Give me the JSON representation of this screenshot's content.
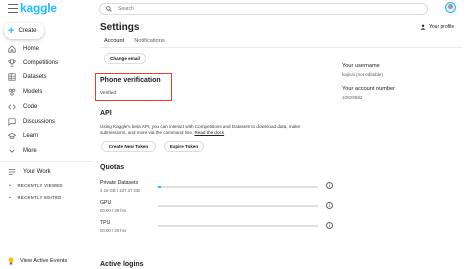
{
  "brand": {
    "logo": "kaggle",
    "accent": "#20beff",
    "highlight": "#e8402f"
  },
  "sidebar": {
    "create_label": "Create",
    "items": [
      {
        "label": "Home",
        "icon": "home-icon"
      },
      {
        "label": "Competitions",
        "icon": "trophy-icon"
      },
      {
        "label": "Datasets",
        "icon": "table-icon"
      },
      {
        "label": "Models",
        "icon": "models-icon"
      },
      {
        "label": "Code",
        "icon": "code-icon"
      },
      {
        "label": "Discussions",
        "icon": "comments-icon"
      },
      {
        "label": "Learn",
        "icon": "school-icon"
      },
      {
        "label": "More",
        "icon": "chevron-down-icon"
      }
    ],
    "your_work": "Your Work",
    "recently_viewed": "RECENTLY VIEWED",
    "recently_edited": "RECENTLY EDITED",
    "active_events": "View Active Events"
  },
  "search": {
    "placeholder": "Search"
  },
  "header": {
    "title": "Settings",
    "your_profile": "Your profile"
  },
  "tabs": [
    {
      "label": "Account",
      "active": true
    },
    {
      "label": "Notifications",
      "active": false
    }
  ],
  "account": {
    "change_email": "Change email",
    "phone": {
      "title": "Phone verification",
      "status": "Verified"
    },
    "api": {
      "title": "API",
      "description": "Using Kaggle's beta API, you can interact with Competitions and Datasets to download data, make submissions, and more via the command line.",
      "link": "Read the docs",
      "create_token": "Create New Token",
      "expire_token": "Expire Token"
    },
    "quotas": {
      "title": "Quotas",
      "items": [
        {
          "name": "Private Datasets",
          "value": "2.15 GB / 107.37 GB",
          "fraction": 0.02
        },
        {
          "name": "GPU",
          "value": "00:00 / 30 hrs",
          "fraction": 0
        },
        {
          "name": "TPU",
          "value": "00:00 / 20 hrs",
          "fraction": 0
        }
      ]
    },
    "active_logins": "Active logins"
  },
  "profile_info": {
    "username_label": "Your username",
    "username_value": "kajicai (not editable)",
    "account_number_label": "Your account number",
    "account_number_value": "10829592"
  }
}
